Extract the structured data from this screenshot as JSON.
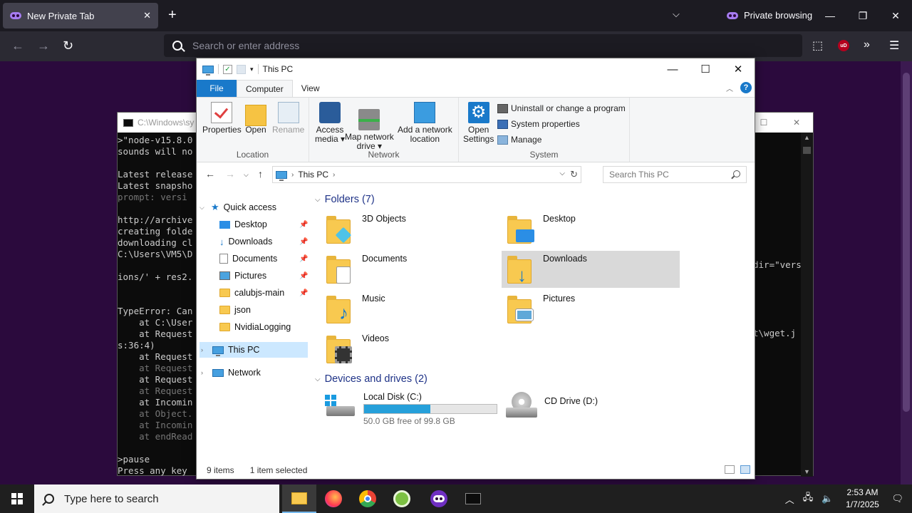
{
  "browser": {
    "tab_title": "New Private Tab",
    "new_tab": "+",
    "private_label": "Private browsing",
    "address_placeholder": "Search or enter address",
    "ublock": "uD"
  },
  "console": {
    "title": "C:\\Windows\\sy",
    "lines": [
      {
        "t": ">\"node-v15.8.0",
        "dim": false
      },
      {
        "t": "sounds will no",
        "dim": false
      },
      {
        "t": "",
        "dim": false
      },
      {
        "t": "Latest release",
        "dim": false
      },
      {
        "t": "Latest snapsho",
        "dim": false
      },
      {
        "t": "prompt: versi",
        "dim": true
      },
      {
        "t": "",
        "dim": false
      },
      {
        "t": "http://archive",
        "dim": false
      },
      {
        "t": "creating folde",
        "dim": false
      },
      {
        "t": "downloading cl",
        "dim": false
      },
      {
        "t": "C:\\Users\\VM5\\D",
        "dim": false
      },
      {
        "t": "",
        "dim": false
      },
      {
        "t": "ions/' + res2.",
        "dim": false
      },
      {
        "t": "",
        "dim": false
      },
      {
        "t": "",
        "dim": false
      },
      {
        "t": "TypeError: Can",
        "dim": false
      },
      {
        "t": "    at C:\\User",
        "dim": false
      },
      {
        "t": "    at Request",
        "dim": false
      },
      {
        "t": "s:36:4)",
        "dim": false
      },
      {
        "t": "    at Request",
        "dim": false
      },
      {
        "t": "    at Request",
        "dim": true
      },
      {
        "t": "    at Request",
        "dim": false
      },
      {
        "t": "    at Request",
        "dim": true
      },
      {
        "t": "    at Incomin",
        "dim": false
      },
      {
        "t": "    at Object.",
        "dim": true
      },
      {
        "t": "    at Incomin",
        "dim": true
      },
      {
        "t": "    at endRead",
        "dim": true
      },
      {
        "t": "",
        "dim": false
      },
      {
        "t": ">pause",
        "dim": false
      },
      {
        "t": "Press any key",
        "dim": false
      }
    ],
    "right_fragment_1": "dir=\"vers",
    "right_fragment_2": "t\\wget.j"
  },
  "explorer": {
    "title": "This PC",
    "ribbon_tabs": [
      "File",
      "Computer",
      "View"
    ],
    "ribbon": {
      "properties": "Properties",
      "open": "Open",
      "rename": "Rename",
      "location_group": "Location",
      "access_media_1": "Access",
      "access_media_2": "media ▾",
      "map_drive_1": "Map network",
      "map_drive_2": "drive ▾",
      "add_loc_1": "Add a network",
      "add_loc_2": "location",
      "network_group": "Network",
      "open_settings_1": "Open",
      "open_settings_2": "Settings",
      "uninstall": "Uninstall or change a program",
      "sys_props": "System properties",
      "manage": "Manage",
      "system_group": "System"
    },
    "address": "This PC",
    "search_placeholder": "Search This PC",
    "nav": {
      "quick_access": "Quick access",
      "desktop": "Desktop",
      "downloads": "Downloads",
      "documents": "Documents",
      "pictures": "Pictures",
      "calubjs": "calubjs-main",
      "json": "json",
      "nvidia": "NvidiaLogging",
      "this_pc": "This PC",
      "network": "Network"
    },
    "folders_header": "Folders (7)",
    "folders": {
      "objects3d": "3D Objects",
      "desktop": "Desktop",
      "documents": "Documents",
      "downloads": "Downloads",
      "music": "Music",
      "pictures": "Pictures",
      "videos": "Videos"
    },
    "drives_header": "Devices and drives (2)",
    "drive_c": {
      "name": "Local Disk (C:)",
      "free": "50.0 GB free of 99.8 GB",
      "used_fraction": 0.499
    },
    "drive_d": {
      "name": "CD Drive (D:)"
    },
    "status_items": "9 items",
    "status_selected": "1 item selected"
  },
  "taskbar": {
    "search_text": "Type here to search",
    "time": "2:53 AM",
    "date": "1/7/2025"
  },
  "colors": {
    "accent": "#1979ca",
    "selection": "#cce8ff",
    "private": "#a67cf0"
  }
}
